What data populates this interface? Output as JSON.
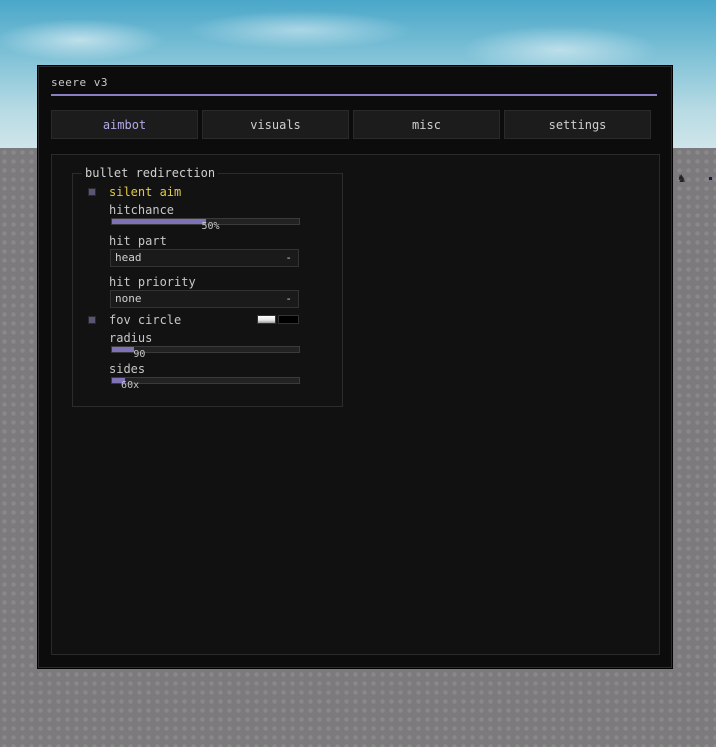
{
  "window": {
    "title": "seere v3",
    "accent_color": "#8d7ec2"
  },
  "tabs": [
    {
      "label": "aimbot",
      "active": true
    },
    {
      "label": "visuals",
      "active": false
    },
    {
      "label": "misc",
      "active": false
    },
    {
      "label": "settings",
      "active": false
    }
  ],
  "section": {
    "title": "bullet redirection",
    "silent_aim": {
      "label": "silent aim",
      "checked": true,
      "label_color": "#e3c94a"
    },
    "hitchance": {
      "label": "hitchance",
      "value": "50%",
      "fraction": 0.5
    },
    "hit_part": {
      "label": "hit part",
      "value": "head",
      "arrow": "-"
    },
    "hit_priority": {
      "label": "hit priority",
      "value": "none",
      "arrow": "-"
    },
    "fov_circle": {
      "label": "fov circle",
      "checked": true,
      "color_primary": "#e6e6e6",
      "color_secondary": "#000000"
    },
    "radius": {
      "label": "radius",
      "value": "90",
      "fraction": 0.12
    },
    "sides": {
      "label": "sides",
      "value": "60x",
      "fraction": 0.07
    }
  }
}
